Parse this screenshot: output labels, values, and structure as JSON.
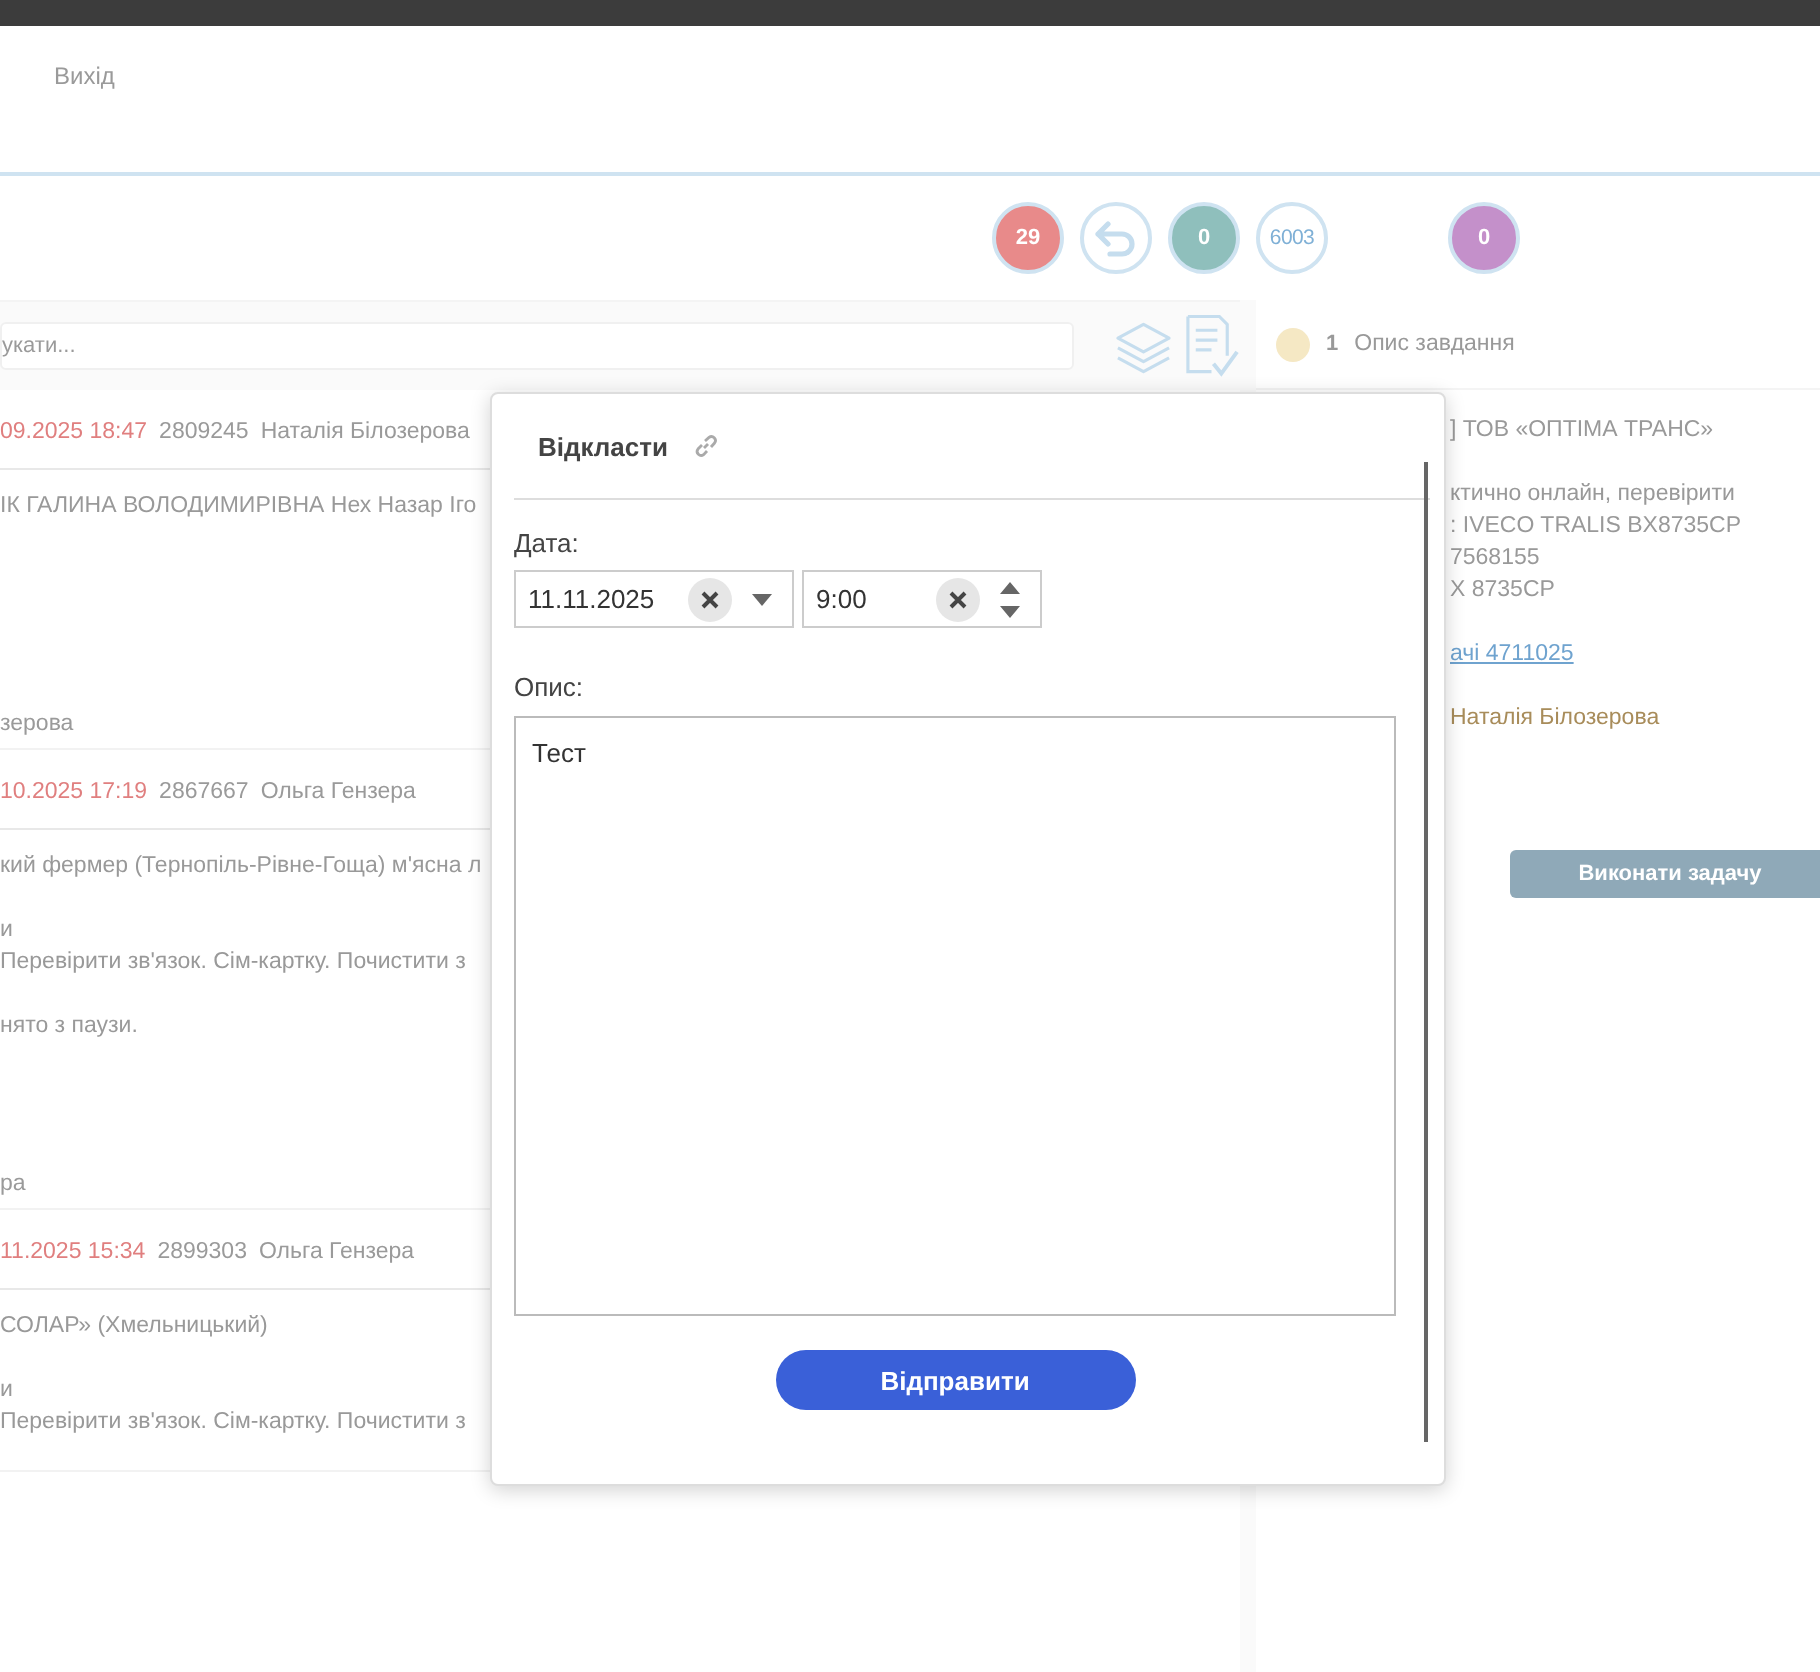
{
  "header": {
    "logout": "Вихід"
  },
  "badges": [
    {
      "kind": "count",
      "label": "29",
      "color": "#e88a8a"
    },
    {
      "kind": "back"
    },
    {
      "kind": "count",
      "label": "0",
      "color": "#8fbfbc"
    },
    {
      "kind": "outline",
      "label": "6003"
    },
    {
      "kind": "count",
      "label": "0",
      "color": "#c490ca"
    }
  ],
  "search": {
    "placeholder": "укати..."
  },
  "tasks": [
    {
      "date": "09.2025 18:47",
      "id": "2809245",
      "author": "Наталія Білозерова",
      "paragraphs": [
        [
          "ІК ГАЛИНА ВОЛОДИМИРІВНА Нех Назар Іго"
        ]
      ],
      "footer": "зерова"
    },
    {
      "date": "10.2025 17:19",
      "id": "2867667",
      "author": "Ольга Гензера",
      "paragraphs": [
        [
          "кий фермер (Тернопіль-Рівне-Гоща) м'ясна л"
        ],
        [
          "и",
          "Перевірити зв'язок. Сім-картку. Почистити з"
        ],
        [
          "нято з паузи."
        ]
      ],
      "footer": "ра"
    },
    {
      "date": "11.2025 15:34",
      "id": "2899303",
      "author": "Ольга Гензера",
      "paragraphs": [
        [
          "СОЛАР» (Хмельницький)"
        ],
        [
          "и",
          "Перевірити зв'язок. Сім-картку. Почистити з"
        ]
      ]
    }
  ],
  "detail": {
    "step": "1",
    "title": "Опис завдання",
    "color": "#f5e8c4",
    "lines": [
      [
        "] ТОВ «ОПТІМА ТРАНС»"
      ],
      [
        "ктично онлайн, перевірити",
        ": IVECO TRALIS BX8735CP",
        "7568155",
        "X 8735CP"
      ]
    ],
    "link": "ачі 4711025",
    "author": "Наталія Білозерова",
    "button": "Виконати задачу"
  },
  "modal": {
    "title": "Відкласти",
    "date_label": "Дата:",
    "date": "11.11.2025",
    "time": "9:00",
    "desc_label": "Опис:",
    "description": "Тест",
    "submit": "Відправити"
  }
}
